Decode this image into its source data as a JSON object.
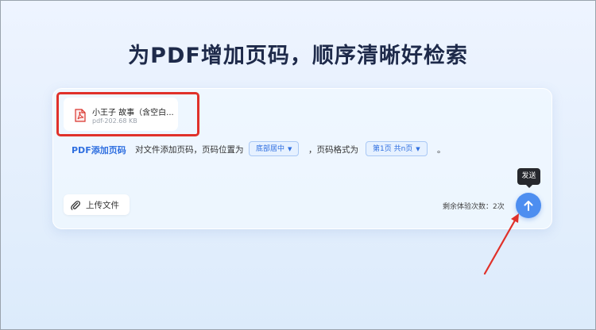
{
  "page": {
    "title": "为PDF增加页码，顺序清晰好检索"
  },
  "file": {
    "name": "小王子 故事（含空白...",
    "size": "pdf-202.68 KB",
    "icon": "pdf-file-icon"
  },
  "tool": {
    "link_label": "PDF添加页码",
    "text_part1": "对文件添加页码，页码位置为",
    "position_value": "底部居中",
    "text_part2": "，页码格式为",
    "format_value": "第1页 共n页",
    "text_end": "。"
  },
  "upload": {
    "label": "上传文件",
    "icon": "paperclip-icon"
  },
  "status": {
    "remaining_text": "剩余体验次数：2次"
  },
  "send": {
    "tooltip": "发送",
    "icon": "arrow-up-icon"
  },
  "colors": {
    "accent": "#2f6fe0",
    "send_button": "#4d8ef0",
    "highlight": "#e0312a",
    "pdf_icon": "#d9332b"
  }
}
